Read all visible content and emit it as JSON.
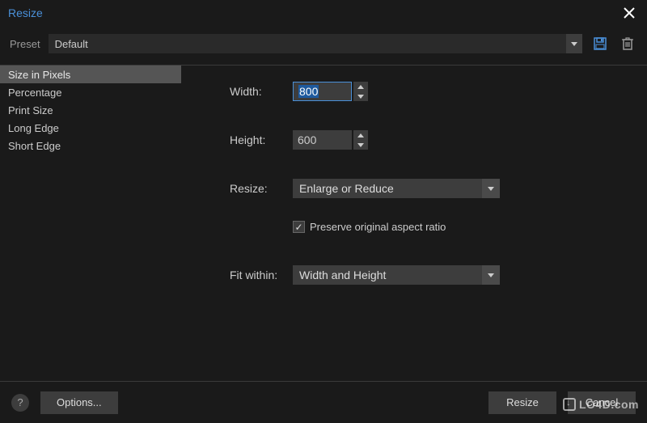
{
  "titlebar": {
    "title": "Resize"
  },
  "preset": {
    "label": "Preset",
    "value": "Default"
  },
  "sidebar": {
    "items": [
      {
        "label": "Size in Pixels",
        "selected": true
      },
      {
        "label": "Percentage",
        "selected": false
      },
      {
        "label": "Print Size",
        "selected": false
      },
      {
        "label": "Long Edge",
        "selected": false
      },
      {
        "label": "Short Edge",
        "selected": false
      }
    ]
  },
  "form": {
    "width_label": "Width:",
    "width_value": "800",
    "height_label": "Height:",
    "height_value": "600",
    "resize_label": "Resize:",
    "resize_value": "Enlarge or Reduce",
    "aspect_label": "Preserve original aspect ratio",
    "aspect_checked": true,
    "fitwithin_label": "Fit within:",
    "fitwithin_value": "Width and Height"
  },
  "footer": {
    "options": "Options...",
    "resize": "Resize",
    "cancel": "Cancel"
  },
  "watermark": "LO4D.com"
}
